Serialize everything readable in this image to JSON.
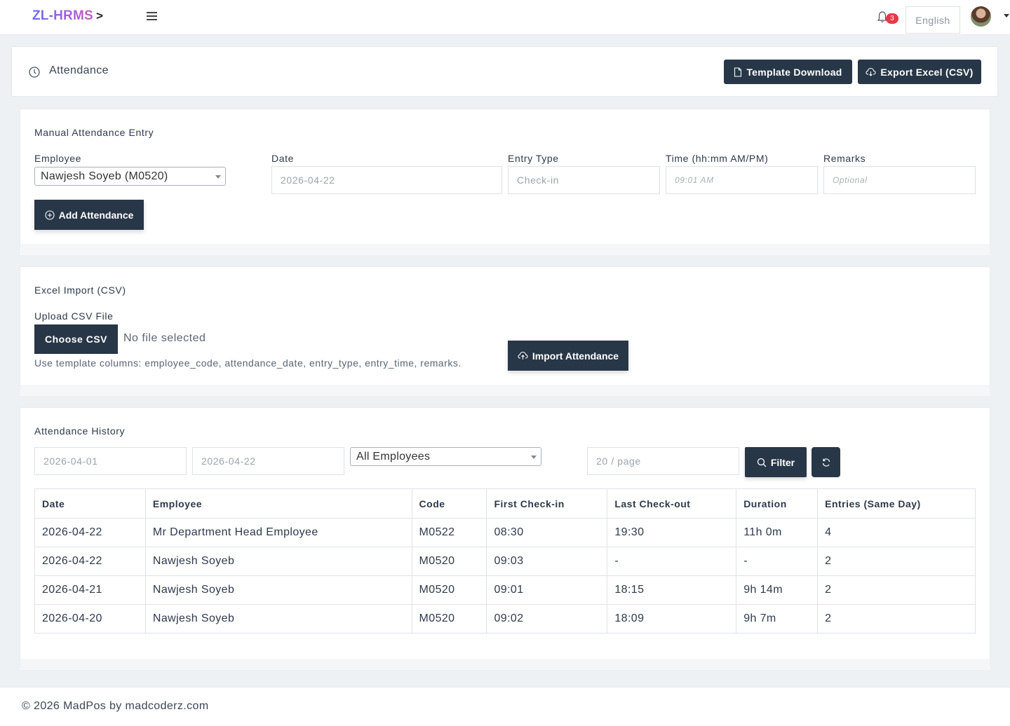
{
  "topbar": {
    "brand": "ZL-HRMS",
    "brand_chevron": ">",
    "notification_count": "3",
    "language": "English"
  },
  "header": {
    "title": "Attendance",
    "template_download_label": "Template Download",
    "export_label": "Export Excel (CSV)"
  },
  "manual_entry": {
    "title": "Manual Attendance Entry",
    "employee_label": "Employee",
    "employee_value": "Nawjesh Soyeb (M0520)",
    "date_label": "Date",
    "date_value": "2026-04-22",
    "entry_type_label": "Entry Type",
    "entry_type_value": "Check-in",
    "time_label": "Time (hh:mm AM/PM)",
    "time_placeholder": "09:01 AM",
    "remarks_label": "Remarks",
    "remarks_placeholder": "Optional",
    "add_button": "Add Attendance"
  },
  "excel_import": {
    "title": "Excel Import (CSV)",
    "upload_label": "Upload CSV File",
    "choose_button": "Choose CSV",
    "file_status": "No file selected",
    "hint": "Use template columns: employee_code, attendance_date, entry_type, entry_time, remarks.",
    "import_button": "Import Attendance"
  },
  "history": {
    "title": "Attendance History",
    "from_date": "2026-04-01",
    "to_date": "2026-04-22",
    "employee_filter": "All Employees",
    "page_size": "20 / page",
    "filter_button": "Filter",
    "columns": [
      "Date",
      "Employee",
      "Code",
      "First Check-in",
      "Last Check-out",
      "Duration",
      "Entries (Same Day)"
    ],
    "rows": [
      [
        "2026-04-22",
        "Mr Department Head Employee",
        "M0522",
        "08:30",
        "19:30",
        "11h 0m",
        "4"
      ],
      [
        "2026-04-22",
        "Nawjesh Soyeb",
        "M0520",
        "09:03",
        "-",
        "-",
        "2"
      ],
      [
        "2026-04-21",
        "Nawjesh Soyeb",
        "M0520",
        "09:01",
        "18:15",
        "9h 14m",
        "2"
      ],
      [
        "2026-04-20",
        "Nawjesh Soyeb",
        "M0520",
        "09:02",
        "18:09",
        "9h 7m",
        "2"
      ]
    ]
  },
  "footer": {
    "text": "© 2026 MadPos by madcoderz.com"
  }
}
